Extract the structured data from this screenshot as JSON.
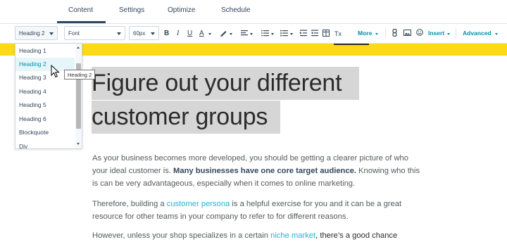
{
  "tabs": [
    {
      "label": "Content",
      "active": true
    },
    {
      "label": "Settings",
      "active": false
    },
    {
      "label": "Optimize",
      "active": false
    },
    {
      "label": "Schedule",
      "active": false
    }
  ],
  "toolbar": {
    "block_style": "Heading 2",
    "font": "Font",
    "font_size": "60px",
    "bold": "B",
    "italic": "I",
    "underline": "U",
    "text_color": "A",
    "clear_format": "Tx",
    "more_label": "More",
    "insert_label": "Insert",
    "advanced_label": "Advanced"
  },
  "heading": {
    "line1": "Figure out your different",
    "line2": "customer groups"
  },
  "body": {
    "p1_a": "As your business becomes more developed, you should be getting a clearer picture of who your ideal customer is. ",
    "p1_bold": "Many businesses have one core target audience.",
    "p1_b": " Knowing who this is can be very advantageous, especially when it comes to online marketing.",
    "p2_a": "Therefore, building a ",
    "p2_link": "customer persona",
    "p2_b": " is a helpful exercise for you and it can be a great resource for other teams in your company to refer to for different reasons.",
    "p3_a": "However, unless your shop specializes in a certain ",
    "p3_link": "niche market",
    "p3_b": ", there’s a good chance"
  },
  "dropdown": {
    "items": [
      "Heading 1",
      "Heading 2",
      "Heading 3",
      "Heading 4",
      "Heading 5",
      "Heading 6",
      "Blockquote",
      "Div"
    ],
    "hovered": "Heading 2"
  },
  "tooltip": "Heading 2",
  "colors": {
    "accent": "#0091ae",
    "link": "#27b3d1",
    "banner": "#fed915",
    "highlight": "#d6d6d6",
    "hover_bg": "#e5f5f8"
  }
}
